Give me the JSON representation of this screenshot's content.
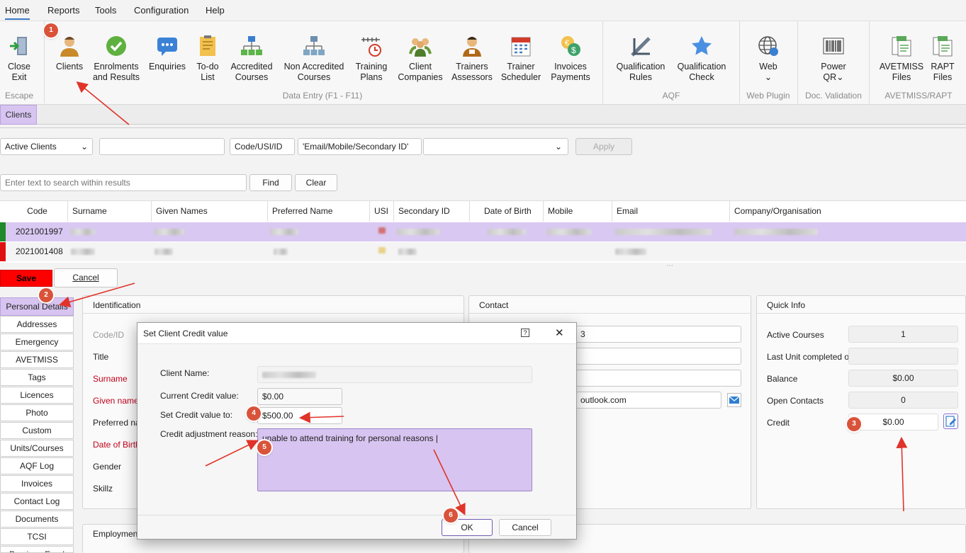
{
  "menu": {
    "items": [
      "Home",
      "Reports",
      "Tools",
      "Configuration",
      "Help"
    ]
  },
  "ribbon": {
    "buttons": [
      {
        "label1": "Close",
        "label2": "Exit",
        "icon": "exit-door-icon"
      },
      {
        "label1": "Clients",
        "label2": "",
        "icon": "person-icon"
      },
      {
        "label1": "Enrolments",
        "label2": "and Results",
        "icon": "check-circle-icon"
      },
      {
        "label1": "Enquiries",
        "label2": "",
        "icon": "chat-bubble-icon"
      },
      {
        "label1": "To-do",
        "label2": "List",
        "icon": "notepad-icon"
      },
      {
        "label1": "Accredited",
        "label2": "Courses",
        "icon": "org-chart-icon"
      },
      {
        "label1": "Non Accredited",
        "label2": "Courses",
        "icon": "org-chart-gray-icon"
      },
      {
        "label1": "Training",
        "label2": "Plans",
        "icon": "timeline-clock-icon"
      },
      {
        "label1": "Client",
        "label2": "Companies",
        "icon": "people-group-icon"
      },
      {
        "label1": "Trainers",
        "label2": "Assessors",
        "icon": "trainer-icon"
      },
      {
        "label1": "Trainer",
        "label2": "Scheduler",
        "icon": "calendar-icon"
      },
      {
        "label1": "Invoices",
        "label2": "Payments",
        "icon": "coins-icon"
      },
      {
        "label1": "Qualification",
        "label2": "Rules",
        "icon": "ruler-pencil-icon"
      },
      {
        "label1": "Qualification",
        "label2": "Check",
        "icon": "star-icon"
      },
      {
        "label1": "Web",
        "label2": "⌄",
        "icon": "globe-icon"
      },
      {
        "label1": "Power",
        "label2": "QR⌄",
        "icon": "barcode-icon"
      },
      {
        "label1": "AVETMISS",
        "label2": "Files",
        "icon": "txt-files-icon"
      },
      {
        "label1": "RAPT",
        "label2": "Files",
        "icon": "txt-files-icon"
      }
    ],
    "groups": [
      "Escape",
      "Data Entry (F1 - F11)",
      "AQF",
      "Web Plugin",
      "Doc. Validation",
      "AVETMISS/RAPT"
    ]
  },
  "tab": {
    "label": "Clients"
  },
  "filters": {
    "status": "Active Clients",
    "code_button": "Code/USI/ID",
    "email_field": "'Email/Mobile/Secondary ID'",
    "apply": "Apply",
    "search_placeholder": "Enter text to search within results",
    "find": "Find",
    "clear": "Clear"
  },
  "grid": {
    "columns": [
      "Code",
      "Surname",
      "Given Names",
      "Preferred Name",
      "USI",
      "Secondary ID",
      "Date of Birth",
      "Mobile",
      "Email",
      "Company/Organisation"
    ],
    "rows": [
      {
        "code": "2021001997",
        "status_color": "#1e8a2a"
      },
      {
        "code": "2021001408",
        "status_color": "#e01010"
      }
    ]
  },
  "actions": {
    "save": "Save",
    "cancel": "Cancel"
  },
  "sidebar": {
    "items": [
      "Personal Details",
      "Addresses",
      "Emergency Contacts",
      "AVETMISS",
      "Tags",
      "Licences",
      "Photo",
      "Custom",
      "Units/Courses",
      "AQF Log",
      "Invoices",
      "Contact Log",
      "Documents",
      "TCSI",
      "Previous Enrol"
    ]
  },
  "identification": {
    "title": "Identification",
    "labels": [
      "Code/ID",
      "Title",
      "Surname",
      "Given names",
      "Preferred nam",
      "Date of Birth",
      "Gender",
      "Skillz"
    ]
  },
  "contact": {
    "title": "Contact",
    "value1": "3",
    "email": "outlook.com"
  },
  "employment": {
    "title": "Employment"
  },
  "quick_info": {
    "title": "Quick Info",
    "rows": [
      {
        "label": "Active Courses",
        "value": "1"
      },
      {
        "label": "Last Unit completed on",
        "value": ""
      },
      {
        "label": "Balance",
        "value": "$0.00"
      },
      {
        "label": "Open Contacts",
        "value": "0"
      },
      {
        "label": "Credit",
        "value": "$0.00"
      }
    ]
  },
  "dialog": {
    "title": "Set Client Credit value",
    "help_glyph": "?",
    "close_glyph": "✕",
    "client_name_label": "Client Name:",
    "current_label": "Current Credit value:",
    "current_value": "$0.00",
    "set_label": "Set Credit value to:",
    "set_value": "$500.00",
    "reason_label": "Credit adjustment reason:",
    "reason_value": "unable to attend training for personal reasons |",
    "ok": "OK",
    "cancel": "Cancel"
  },
  "annotations": {
    "badges": [
      "1",
      "2",
      "3",
      "4",
      "5",
      "6"
    ],
    "color": "#d9533a"
  }
}
